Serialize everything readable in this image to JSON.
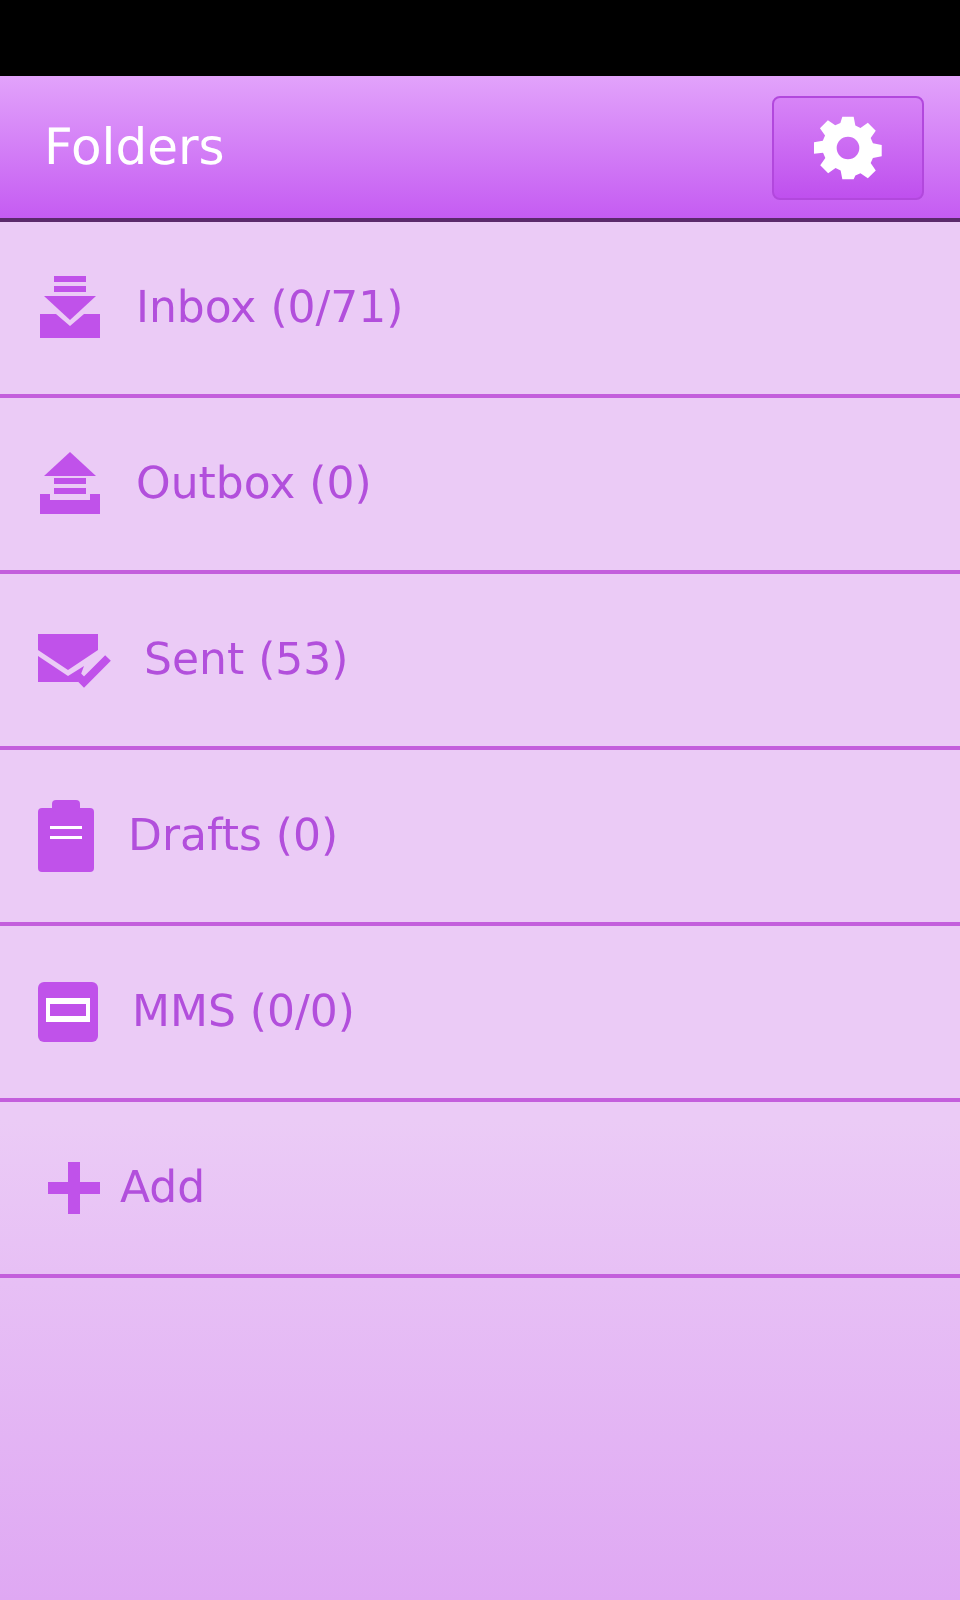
{
  "header": {
    "title": "Folders"
  },
  "folders": [
    {
      "kind": "inbox",
      "label": "Inbox (0/71)"
    },
    {
      "kind": "outbox",
      "label": "Outbox (0)"
    },
    {
      "kind": "sent",
      "label": "Sent (53)"
    },
    {
      "kind": "drafts",
      "label": "Drafts (0)"
    },
    {
      "kind": "mms",
      "label": "MMS (0/0)"
    },
    {
      "kind": "add",
      "label": "Add"
    }
  ]
}
